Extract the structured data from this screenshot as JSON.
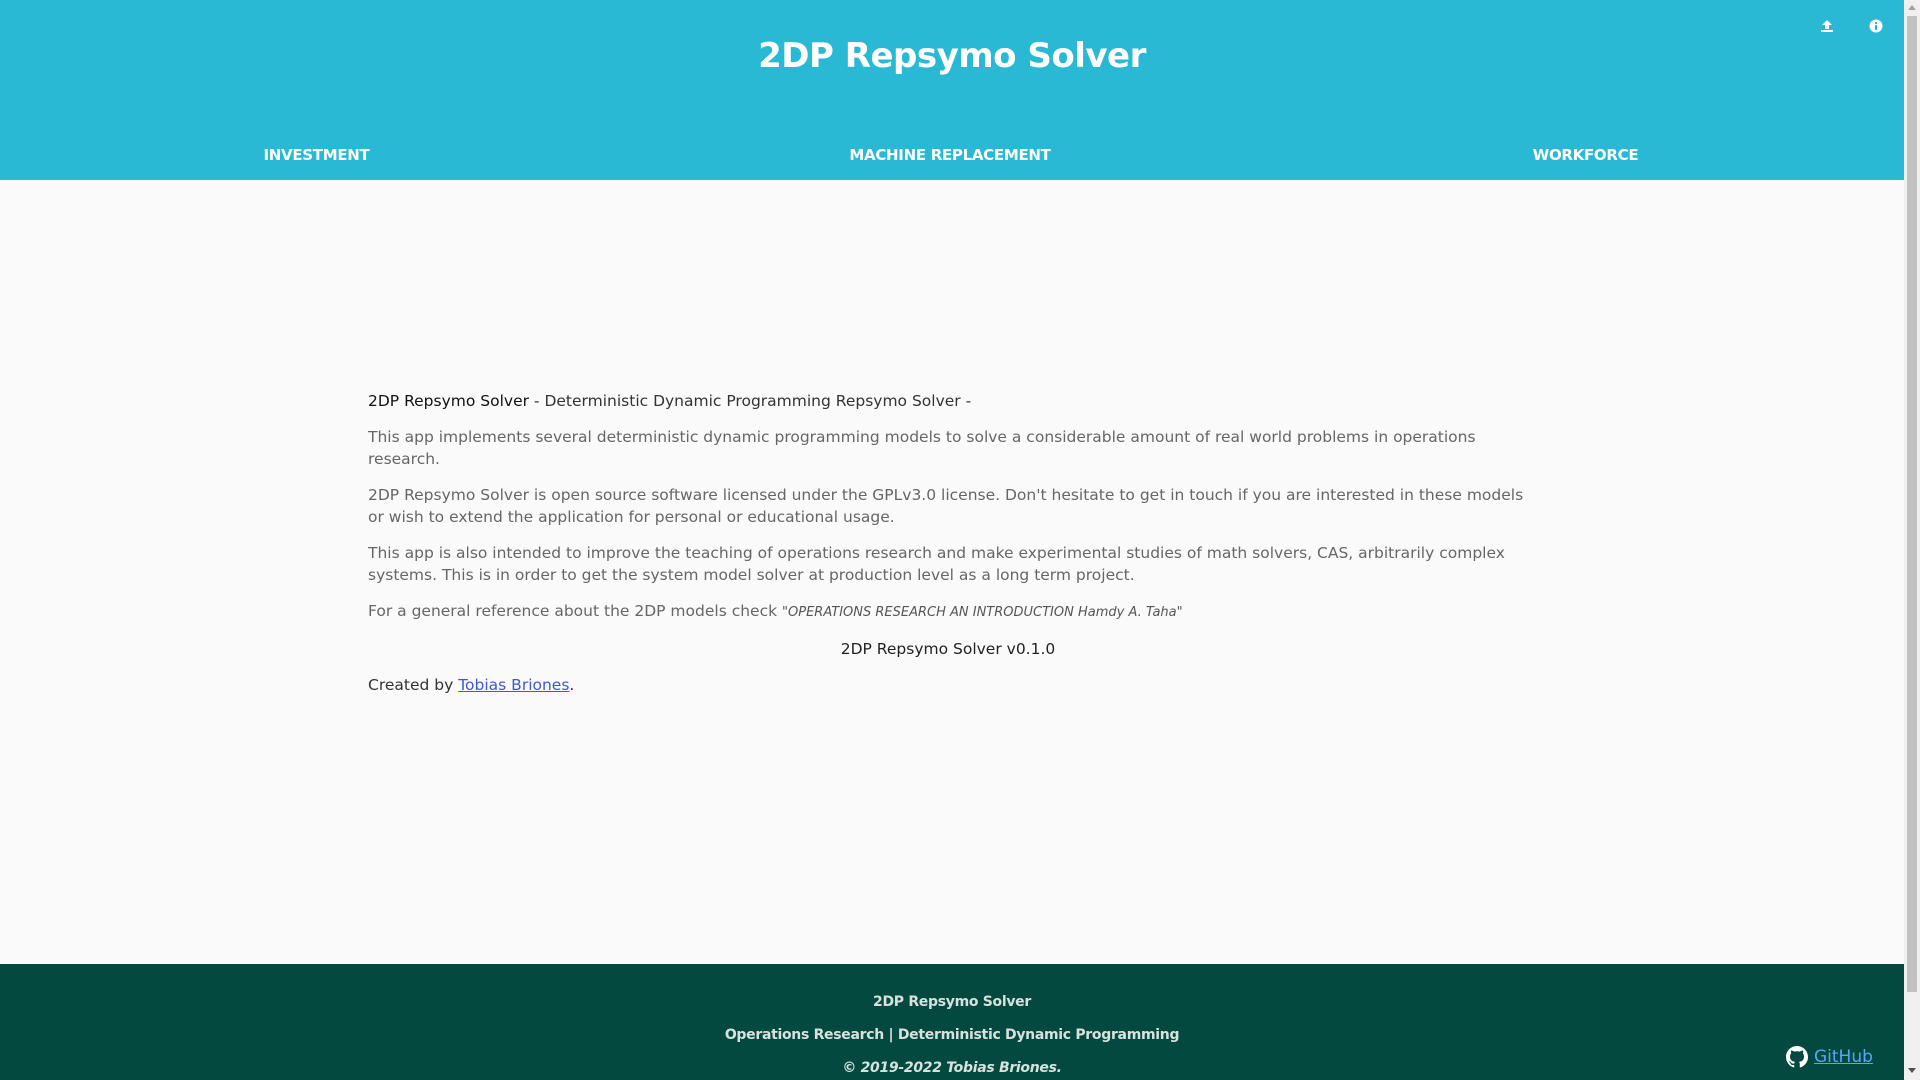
{
  "header": {
    "title": "2DP Repsymo Solver",
    "upload_icon": "upload-icon",
    "info_icon": "info-icon",
    "background": "#29b9d4"
  },
  "tabs": [
    {
      "label": "INVESTMENT"
    },
    {
      "label": "MACHINE REPLACEMENT"
    },
    {
      "label": "WORKFORCE"
    }
  ],
  "main": {
    "intro_name": "2DP Repsymo Solver",
    "intro_rest": " - Deterministic Dynamic Programming Repsymo Solver -",
    "para1": "This app implements several deterministic dynamic programming models to solve a considerable amount of real world problems in operations research.",
    "para2": "2DP Repsymo Solver is open source software licensed under the GPLv3.0 license. Don't hesitate to get in touch if you are interested in these models or wish to extend the application for personal or educational usage.",
    "para3": "This app is also intended to improve the teaching of operations research and make experimental studies of math solvers, CAS, arbitrarily complex systems. This is in order to get the system model solver at production level as a long term project.",
    "reference_prefix": "For a general reference about the 2DP models check ",
    "reference_book": "\"OPERATIONS RESEARCH AN INTRODUCTION Hamdy A. Taha\"",
    "version": "2DP Repsymo Solver v0.1.0",
    "created_prefix": "Created by ",
    "author": "Tobias Briones",
    "created_suffix": "."
  },
  "footer": {
    "line1": "2DP Repsymo Solver",
    "line2": "Operations Research | Deterministic Dynamic Programming",
    "line3": "© 2019-2022 Tobias Briones.",
    "github_label": " GitHub",
    "github_icon": "github-icon",
    "background": "#03493f"
  }
}
